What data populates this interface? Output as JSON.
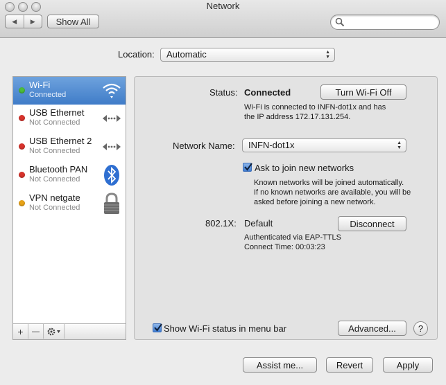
{
  "window": {
    "title": "Network"
  },
  "toolbar": {
    "back_glyph": "◀",
    "forward_glyph": "▶",
    "show_all_label": "Show All",
    "search_placeholder": ""
  },
  "location": {
    "label": "Location:",
    "value": "Automatic"
  },
  "services": [
    {
      "name": "Wi-Fi",
      "status": "Connected",
      "status_color": "#4cbd3a",
      "icon": "wifi-icon",
      "selected": true
    },
    {
      "name": "USB Ethernet",
      "status": "Not Connected",
      "status_color": "#d8332c",
      "icon": "ethernet-icon",
      "selected": false
    },
    {
      "name": "USB Ethernet 2",
      "status": "Not Connected",
      "status_color": "#d8332c",
      "icon": "ethernet-icon",
      "selected": false
    },
    {
      "name": "Bluetooth PAN",
      "status": "Not Connected",
      "status_color": "#d8332c",
      "icon": "bluetooth-icon",
      "selected": false
    },
    {
      "name": "VPN netgate",
      "status": "Not Connected",
      "status_color": "#e8a317",
      "icon": "lock-icon",
      "selected": false
    }
  ],
  "sidebar_footer": {
    "add": "+",
    "remove": "—"
  },
  "detail": {
    "status_label": "Status:",
    "status_value": "Connected",
    "turn_off_button": "Turn Wi-Fi Off",
    "status_desc_line1": "Wi-Fi is connected to INFN-dot1x and has",
    "status_desc_line2": "the IP address 172.17.131.254.",
    "network_name_label": "Network Name:",
    "network_name_value": "INFN-dot1x",
    "ask_to_join_label": "Ask to join new networks",
    "ask_to_join_checked": true,
    "ask_desc_line1": "Known networks will be joined automatically.",
    "ask_desc_line2": "If no known networks are available, you will be",
    "ask_desc_line3": "asked before joining a new network.",
    "dot1x_label": "802.1X:",
    "dot1x_value": "Default",
    "disconnect_button": "Disconnect",
    "auth_line1": "Authenticated via EAP-TTLS",
    "auth_line2": "Connect Time: 00:03:23",
    "show_status_label": "Show Wi-Fi status in menu bar",
    "show_status_checked": true,
    "advanced_button": "Advanced...",
    "help_glyph": "?"
  },
  "footer": {
    "assist_button": "Assist me...",
    "revert_button": "Revert",
    "apply_button": "Apply"
  },
  "colors": {
    "selection": "#4a86cf",
    "accent": "#3f7cd0"
  }
}
